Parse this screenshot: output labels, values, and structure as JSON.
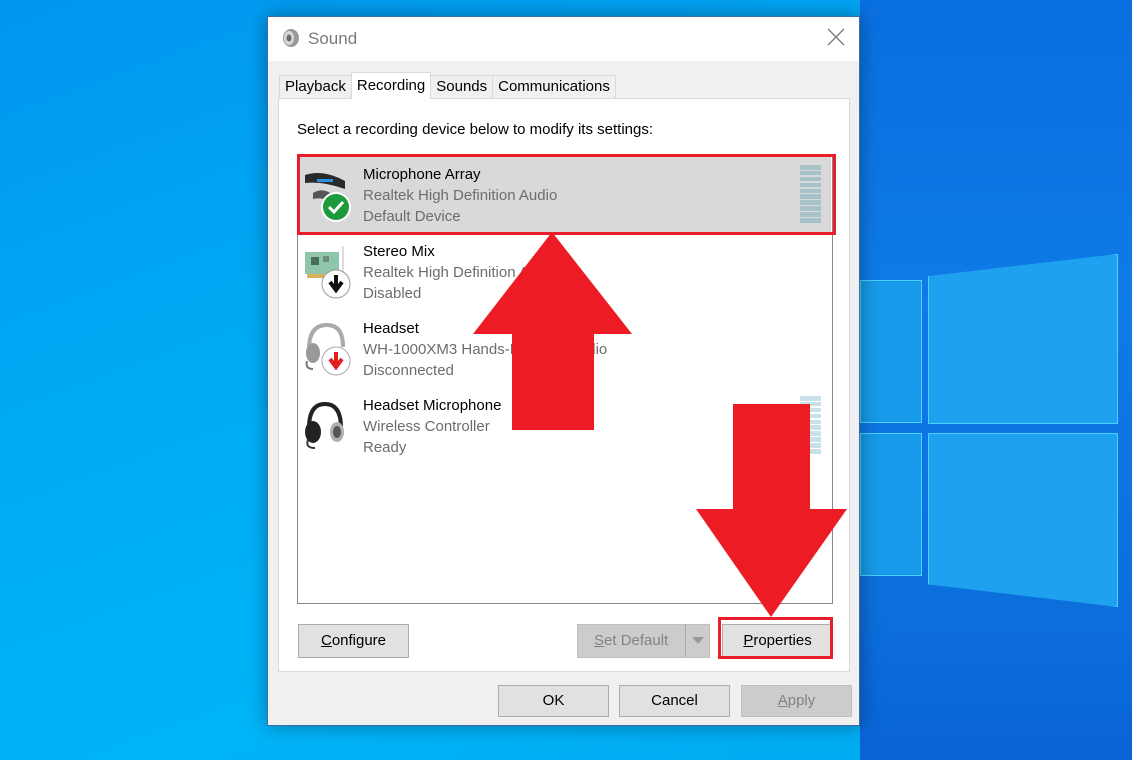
{
  "window": {
    "title": "Sound",
    "close_icon": "close-icon",
    "app_icon": "speaker-icon"
  },
  "tabs": [
    {
      "label": "Playback",
      "active": false
    },
    {
      "label": "Recording",
      "active": true
    },
    {
      "label": "Sounds",
      "active": false
    },
    {
      "label": "Communications",
      "active": false
    }
  ],
  "instruction": "Select a recording device below to modify its settings:",
  "devices": [
    {
      "name": "Microphone Array",
      "description": "Realtek High Definition Audio",
      "status": "Default Device",
      "icon": "microphone-array-icon",
      "badge": "check-badge-icon",
      "selected": true,
      "level_meter": true
    },
    {
      "name": "Stereo Mix",
      "description": "Realtek High Definition Audio",
      "status": "Disabled",
      "icon": "sound-card-icon",
      "badge": "down-arrow-badge-icon",
      "selected": false,
      "level_meter": false
    },
    {
      "name": "Headset",
      "description": "WH-1000XM3 Hands-Free AG Audio",
      "status": "Disconnected",
      "icon": "headset-icon",
      "badge": "red-down-arrow-badge-icon",
      "selected": false,
      "level_meter": false
    },
    {
      "name": "Headset Microphone",
      "description": "Wireless Controller",
      "status": "Ready",
      "icon": "headset-icon",
      "badge": null,
      "selected": false,
      "level_meter": true
    }
  ],
  "buttons": {
    "configure": {
      "label_first": "C",
      "label_rest": "onfigure",
      "enabled": true
    },
    "set_default": {
      "label_first": "S",
      "label_rest": "et Default",
      "enabled": false
    },
    "properties": {
      "label_first": "P",
      "label_rest": "roperties",
      "enabled": true
    },
    "ok": {
      "label": "OK",
      "enabled": true
    },
    "cancel": {
      "label": "Cancel",
      "enabled": true
    },
    "apply": {
      "label_first": "A",
      "label_rest": "pply",
      "enabled": false
    }
  },
  "annotations": {
    "highlight_color": "#e81e2a",
    "up_arrow_target": "Microphone Array",
    "down_arrow_target": "Properties"
  }
}
